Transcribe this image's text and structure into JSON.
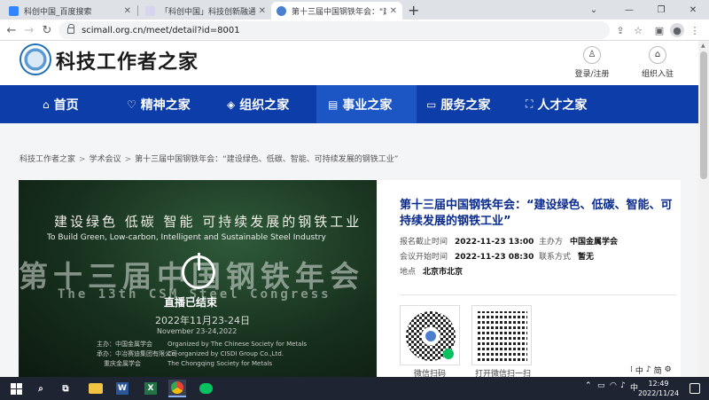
{
  "browser": {
    "tabs": [
      {
        "title": "科创中国_百度搜索",
        "favicon_color": "#3385ff",
        "active": false
      },
      {
        "title": "「科创中国」科技创新融通平台",
        "favicon_color": "#e0e0f0",
        "active": false
      },
      {
        "title": "第十三届中国钢铁年会：\"建设绿",
        "favicon_color": "#4a7fd0",
        "active": true
      }
    ],
    "url": "scimall.org.cn/meet/detail?id=8001"
  },
  "site": {
    "logo_text": "科技工作者之家",
    "login_label": "登录/注册",
    "org_entry_label": "组织入驻",
    "nav": [
      {
        "icon": "⌂",
        "label": "首页"
      },
      {
        "icon": "♡",
        "label": "精神之家"
      },
      {
        "icon": "◈",
        "label": "组织之家"
      },
      {
        "icon": "▤",
        "label": "事业之家"
      },
      {
        "icon": "▭",
        "label": "服务之家"
      },
      {
        "icon": "⛶",
        "label": "人才之家"
      }
    ]
  },
  "breadcrumb": {
    "items": [
      "科技工作者之家",
      "学术会议",
      "第十三届中国钢铁年会：“建设绿色、低碳、智能、可持续发展的钢铁工业”"
    ],
    "separator": ">"
  },
  "banner": {
    "slogan_cn": "建设绿色 低碳 智能 可持续发展的钢铁工业",
    "slogan_en": "To Build Green, Low-carbon, Intelligent and Sustainable Steel Industry",
    "big_cn": "第十三届中国钢铁年会",
    "big_en": "The 13th CSM Steel Congress",
    "date_cn": "2022年11月23-24日",
    "date_en": "November 23-24,2022",
    "orgs": [
      {
        "role": "主办：中国金属学会",
        "en": "Organized by The Chinese Society for Metals"
      },
      {
        "role": "承办：中冶赛迪集团有限公司",
        "en": "Co-organized by CISDI Group Co.,Ltd."
      },
      {
        "role": "重庆金属学会",
        "en": "The Chongqing Society for Metals"
      }
    ],
    "live_status": "直播已结束"
  },
  "meeting": {
    "title": "第十三届中国钢铁年会：“建设绿色、低碳、智能、可持续发展的钢铁工业”",
    "deadline_label": "报名截止时间",
    "deadline_value": "2022-11-23 13:00",
    "organizer_label": "主办方",
    "organizer_value": "中国金属学会",
    "start_label": "会议开始时间",
    "start_value": "2022-11-23 08:30",
    "contact_label": "联系方式",
    "contact_value": "暂无",
    "location_label": "地点",
    "location_value": "北京市北京",
    "qr1_caption": "微信扫码",
    "qr2_caption": "打开微信扫一扫"
  },
  "ime": {
    "items": [
      "中",
      "♪",
      "简",
      "⚙"
    ]
  },
  "taskbar": {
    "time": "12:49",
    "date": "2022/11/24",
    "lang": "中"
  },
  "colors": {
    "nav_bg": "#0d3da8",
    "nav_active": "#1c55c4",
    "title_blue": "#0b2b8c"
  }
}
